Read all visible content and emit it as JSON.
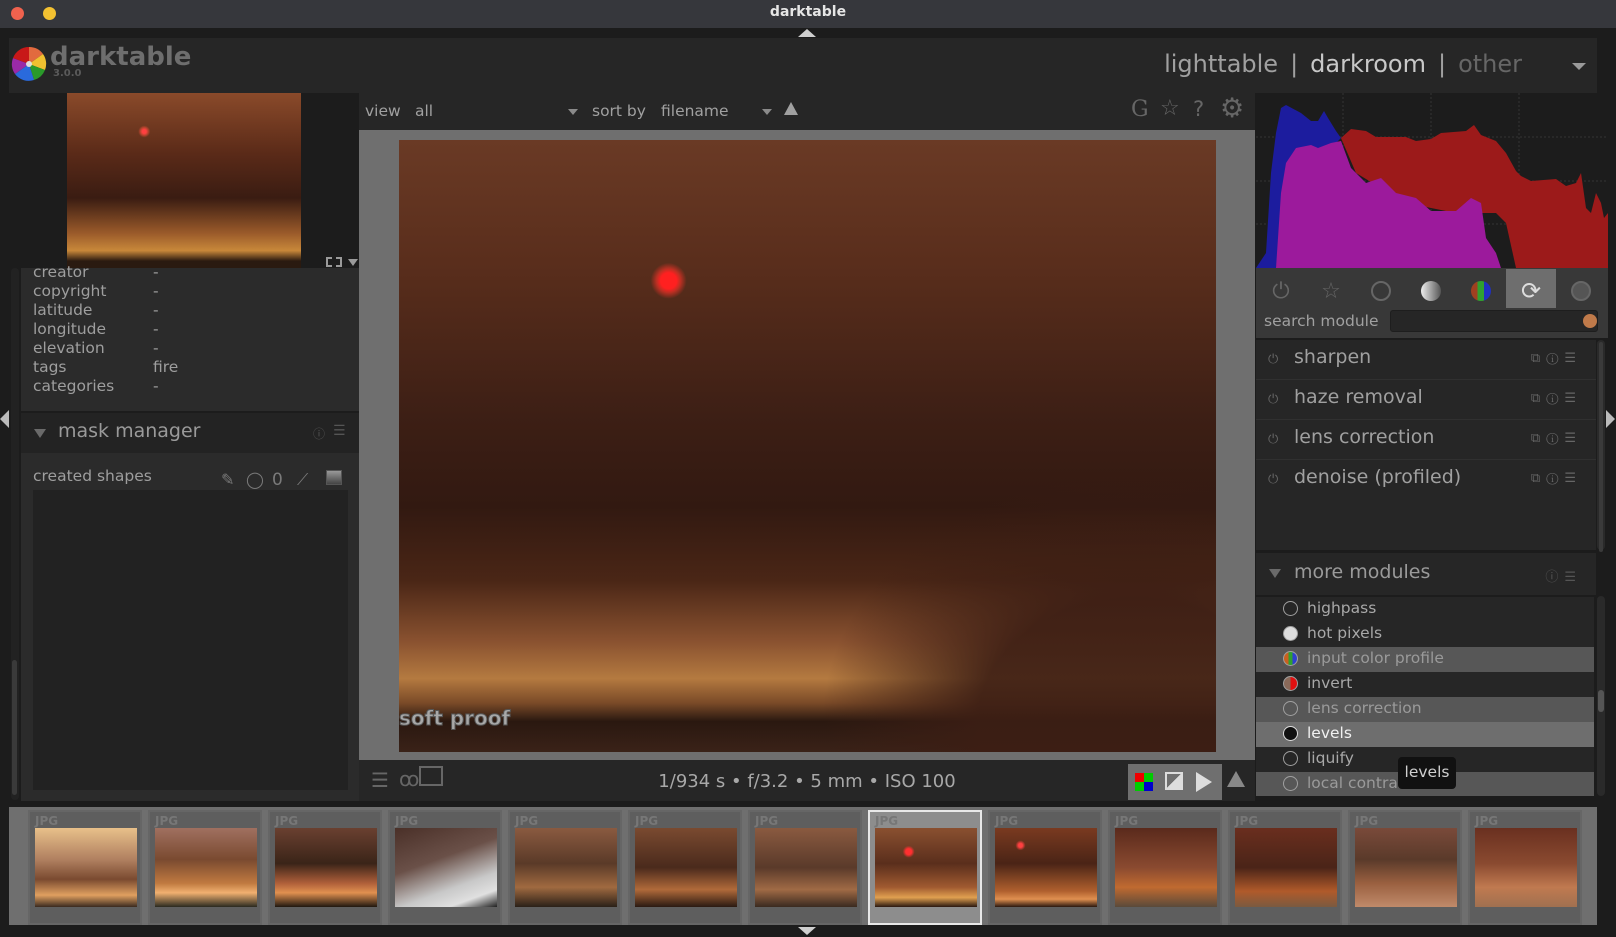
{
  "window": {
    "title": "darktable",
    "close_color": "#f0624e",
    "minimize_color": "#f3c131"
  },
  "app": {
    "name": "darktable",
    "version": "3.0.0"
  },
  "views": {
    "items": [
      "lighttable",
      "darkroom",
      "other"
    ],
    "separator": "|",
    "active": "darkroom"
  },
  "metadata": [
    {
      "label": "creator",
      "value": "-"
    },
    {
      "label": "copyright",
      "value": "-"
    },
    {
      "label": "latitude",
      "value": "-"
    },
    {
      "label": "longitude",
      "value": "-"
    },
    {
      "label": "elevation",
      "value": "-"
    },
    {
      "label": "tags",
      "value": "fire"
    },
    {
      "label": "categories",
      "value": "-"
    }
  ],
  "mask_manager": {
    "title": "mask manager",
    "created_shapes_label": "created shapes",
    "shape_tools": [
      "brush-icon",
      "circle-icon",
      "ellipse-icon",
      "path-icon",
      "gradient-icon"
    ]
  },
  "top_toolbar": {
    "view_label": "view",
    "view_value": "all",
    "sort_label": "sort by",
    "sort_value": "filename",
    "sort_order_icon": "sort-ascending-icon",
    "right_icons": {
      "grouping": "G",
      "star": "☆",
      "help": "?",
      "settings": "⚙"
    }
  },
  "image": {
    "overlay_label": "soft proof",
    "exif": "1/934 s • f/3.2 • 5 mm • ISO 100"
  },
  "bottom_toolbar": {
    "left_icons": [
      "presets-icon",
      "styles-icon",
      "second-window-icon"
    ],
    "right_icons": [
      "raw-overexposed-icon",
      "clipping-icon",
      "softproof-icon",
      "gamut-check-icon"
    ]
  },
  "right_panel": {
    "module_groups": [
      "active-modules-icon",
      "favorites-icon",
      "basic-group-icon",
      "tone-group-icon",
      "color-group-icon",
      "correct-group-icon",
      "effect-group-icon"
    ],
    "active_group": "correct-group-icon",
    "search_label": "search module",
    "search_value": "",
    "modules": [
      {
        "name": "sharpen"
      },
      {
        "name": "haze removal"
      },
      {
        "name": "lens correction"
      },
      {
        "name": "denoise (profiled)"
      }
    ],
    "more_modules": {
      "title": "more modules",
      "items": [
        {
          "name": "highpass",
          "state": "off"
        },
        {
          "name": "hot pixels",
          "state": "off"
        },
        {
          "name": "input color profile",
          "state": "on"
        },
        {
          "name": "invert",
          "state": "off"
        },
        {
          "name": "lens correction",
          "state": "on"
        },
        {
          "name": "levels",
          "state": "selected"
        },
        {
          "name": "liquify",
          "state": "off"
        },
        {
          "name": "local contrast",
          "state": "on"
        }
      ]
    },
    "tooltip": "levels"
  },
  "histogram": {
    "colors": {
      "blue": "#1c1c9e",
      "red": "#9c1a1a",
      "magenta": "#9c1a9c"
    }
  },
  "filmstrip": {
    "format_label": "JPG",
    "count": 13,
    "active_index": 7
  }
}
